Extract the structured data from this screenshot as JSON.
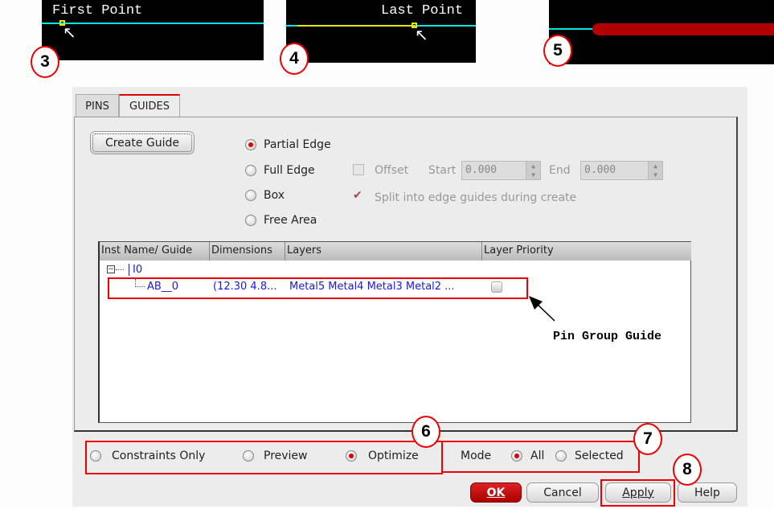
{
  "steps": {
    "step3": {
      "number": "3",
      "label": "First Point"
    },
    "step4": {
      "number": "4",
      "label": "Last Point"
    },
    "step5": {
      "number": "5"
    },
    "step6": {
      "number": "6"
    },
    "step7": {
      "number": "7"
    },
    "step8": {
      "number": "8"
    }
  },
  "tabs": [
    {
      "label": "PINS",
      "active": false
    },
    {
      "label": "GUIDES",
      "active": true
    }
  ],
  "create_guide_label": "Create Guide",
  "guide_types": [
    {
      "label": "Partial Edge",
      "selected": true
    },
    {
      "label": "Full Edge",
      "selected": false
    },
    {
      "label": "Box",
      "selected": false
    },
    {
      "label": "Free Area",
      "selected": false
    }
  ],
  "offset": {
    "label": "Offset",
    "checked": false,
    "start_label": "Start",
    "start_value": "0.000",
    "end_label": "End",
    "end_value": "0.000"
  },
  "split": {
    "label": "Split into edge guides during create",
    "checked": true
  },
  "table": {
    "columns": [
      "Inst Name/ Guide",
      "Dimensions",
      "Layers",
      "Layer Priority"
    ],
    "parent": "I0",
    "rows": [
      {
        "name": "AB__0",
        "dimensions": "(12.30 4.8...",
        "layers": "Metal5 Metal4 Metal3 Metal2 ...",
        "priority_checked": false
      }
    ]
  },
  "annotation": "Pin Group Guide",
  "run_modes": [
    {
      "label": "Constraints Only",
      "selected": false
    },
    {
      "label": "Preview",
      "selected": false
    },
    {
      "label": "Optimize",
      "selected": true
    }
  ],
  "mode": {
    "label": "Mode",
    "options": [
      {
        "label": "All",
        "selected": true
      },
      {
        "label": "Selected",
        "selected": false
      }
    ]
  },
  "buttons": {
    "ok": "OK",
    "cancel": "Cancel",
    "apply": "Apply",
    "help": "Help"
  },
  "colors": {
    "accent": "#dd0000",
    "cyan": "#00e5e5",
    "yellow": "#e5e500",
    "wire": "#b00000"
  }
}
